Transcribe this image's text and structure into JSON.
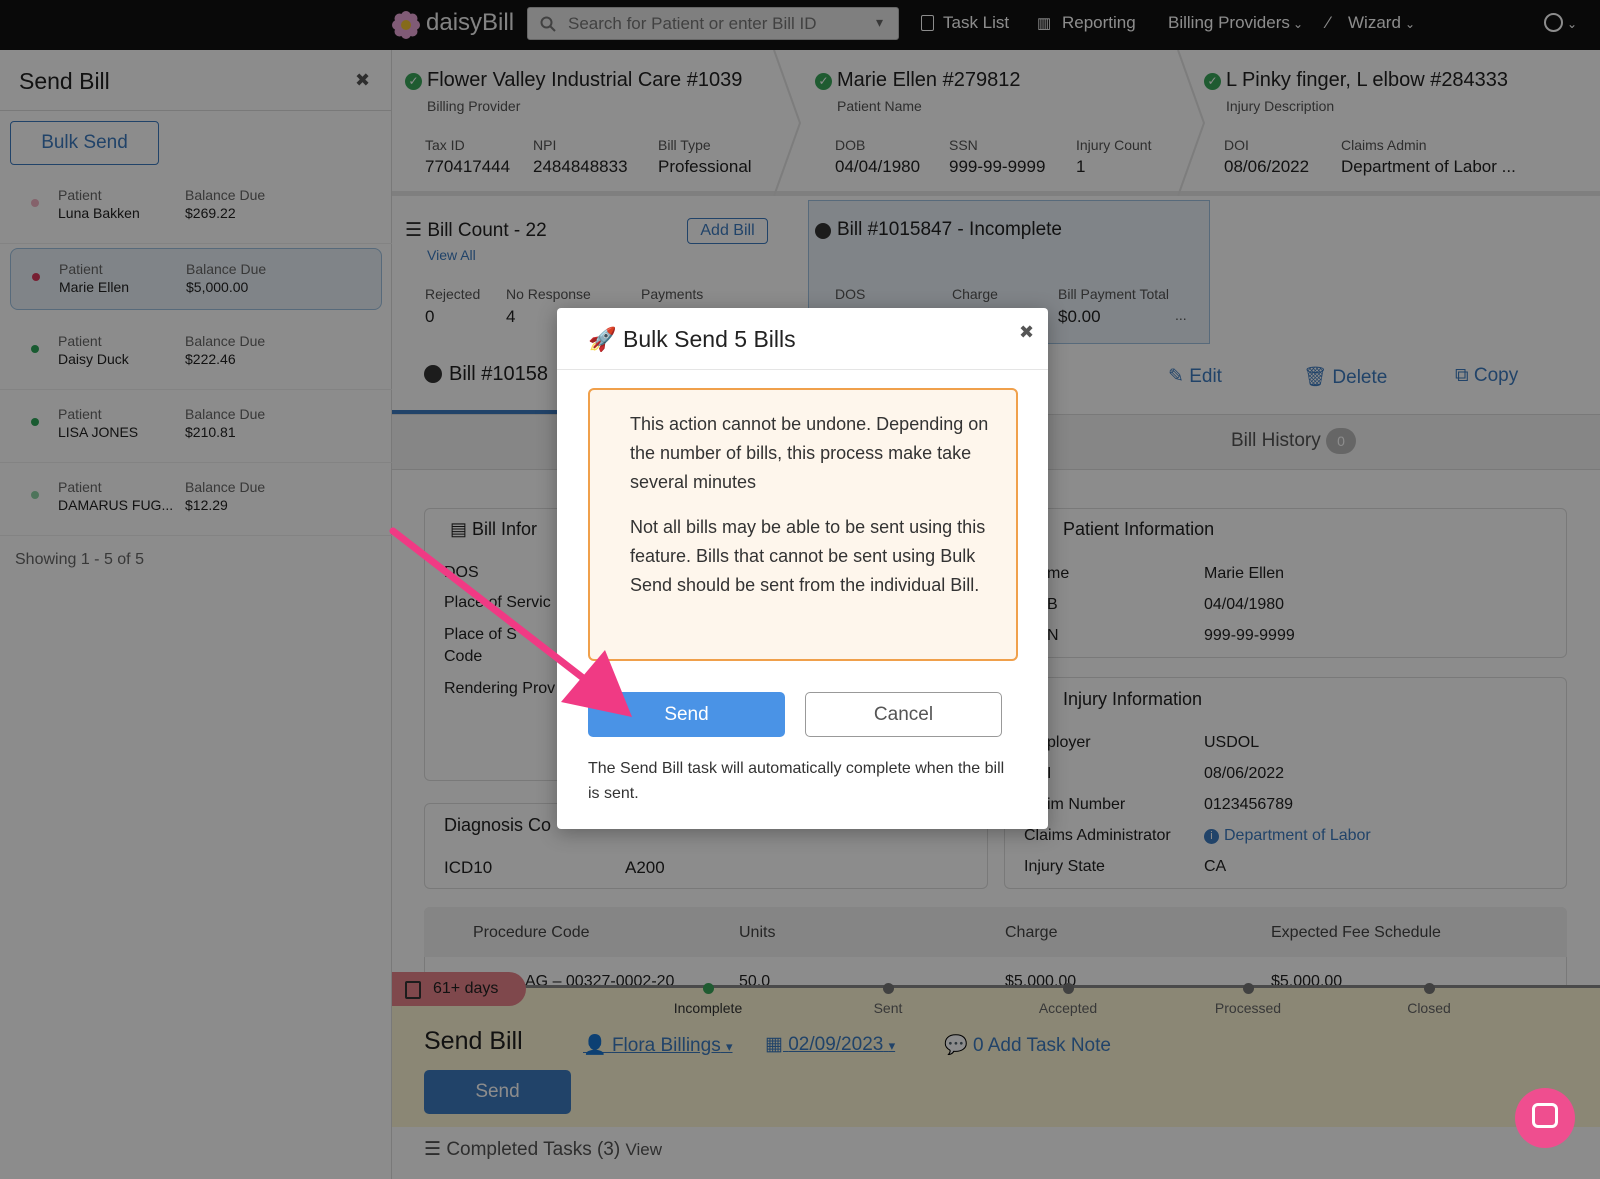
{
  "nav": {
    "brand": "daisyBill",
    "search_placeholder": "Search for Patient or enter Bill ID",
    "task_list": "Task List",
    "reporting": "Reporting",
    "billing_providers": "Billing Providers",
    "wizard": "Wizard"
  },
  "sidebar": {
    "title": "Send Bill",
    "bulk_send": "Bulk Send",
    "patient_label": "Patient",
    "balance_label": "Balance Due",
    "patients": [
      {
        "name": "Luna Bakken",
        "balance": "$269.22",
        "color": "#f2b3c3"
      },
      {
        "name": "Marie Ellen",
        "balance": "$5,000.00",
        "color": "#d93a5c"
      },
      {
        "name": "Daisy Duck",
        "balance": "$222.46",
        "color": "#2fa65a"
      },
      {
        "name": "LISA JONES",
        "balance": "$210.81",
        "color": "#2fa65a"
      },
      {
        "name": "DAMARUS FUG...",
        "balance": "$12.29",
        "color": "#8fd4a6"
      }
    ],
    "showing": "Showing 1 - 5 of 5"
  },
  "header": {
    "provider": {
      "title": "Flower Valley Industrial Care #1039",
      "sub": "Billing Provider",
      "tax_id_label": "Tax ID",
      "tax_id": "770417444",
      "npi_label": "NPI",
      "npi": "2484848833",
      "bill_type_label": "Bill Type",
      "bill_type": "Professional"
    },
    "patient": {
      "title": "Marie Ellen #279812",
      "sub": "Patient Name",
      "dob_label": "DOB",
      "dob": "04/04/1980",
      "ssn_label": "SSN",
      "ssn": "999-99-9999",
      "injury_count_label": "Injury Count",
      "injury_count": "1"
    },
    "injury": {
      "title": "L Pinky finger, L elbow #284333",
      "sub": "Injury Description",
      "doi_label": "DOI",
      "doi": "08/06/2022",
      "claims_admin_label": "Claims Admin",
      "claims_admin": "Department of Labor ..."
    }
  },
  "billcount": {
    "title": "Bill Count - 22",
    "view_all": "View All",
    "add_bill": "Add Bill",
    "rejected_label": "Rejected",
    "rejected": "0",
    "no_response_label": "No Response",
    "no_response": "4",
    "payments_label": "Payments"
  },
  "billcard": {
    "title": "Bill #1015847 - Incomplete",
    "dos_label": "DOS",
    "charge_label": "Charge",
    "payment_total_label": "Bill Payment Total",
    "payment_total": "$0.00",
    "more": "..."
  },
  "bill_section": {
    "title": "Bill #10158",
    "edit": "Edit",
    "delete": "Delete",
    "copy": "Copy",
    "history": "Bill History",
    "history_count": "0"
  },
  "bill_info": {
    "title": "Bill Infor",
    "rows": [
      "DOS",
      "Place of Servic",
      "Place of S",
      "Code",
      "Rendering Prov"
    ]
  },
  "patient_info": {
    "title": "Patient Information",
    "rows": [
      {
        "label": "me",
        "value": "Marie Ellen"
      },
      {
        "label": "B",
        "value": "04/04/1980"
      },
      {
        "label": "N",
        "value": "999-99-9999"
      }
    ]
  },
  "injury_info": {
    "title": "Injury Information",
    "rows": [
      {
        "label": "ployer",
        "value": "USDOL"
      },
      {
        "label": "I",
        "value": "08/06/2022"
      },
      {
        "label": "im Number",
        "value": "0123456789"
      },
      {
        "label": "Claims Administrator",
        "value": "Department of Labor"
      },
      {
        "label": "Injury State",
        "value": "CA"
      }
    ]
  },
  "diagnosis": {
    "title": "Diagnosis Co",
    "code_type": "ICD10",
    "code": "A200"
  },
  "procedure": {
    "headers": [
      "Procedure Code",
      "Units",
      "Charge",
      "Expected Fee Schedule"
    ],
    "row": [
      "AG – 00327-0002-20",
      "50.0",
      "$5,000.00",
      "$5,000.00"
    ]
  },
  "task": {
    "age": "61+ days",
    "stages": [
      "Incomplete",
      "Sent",
      "Accepted",
      "Processed",
      "Closed"
    ],
    "title": "Send Bill",
    "assignee": "Flora Billings",
    "date": "02/09/2023",
    "note": "0 Add Task Note",
    "send": "Send",
    "completed": "Completed Tasks (3)",
    "view": "View"
  },
  "modal": {
    "title": "Bulk Send 5 Bills",
    "warning1": "This action cannot be undone. Depending on the number of bills, this process make take several minutes",
    "warning2": "Not all bills may be able to be sent using this feature. Bills that cannot be sent using Bulk Send should be sent from the individual Bill.",
    "send": "Send",
    "cancel": "Cancel",
    "footer": "The Send Bill task will automatically complete when the bill is sent."
  }
}
